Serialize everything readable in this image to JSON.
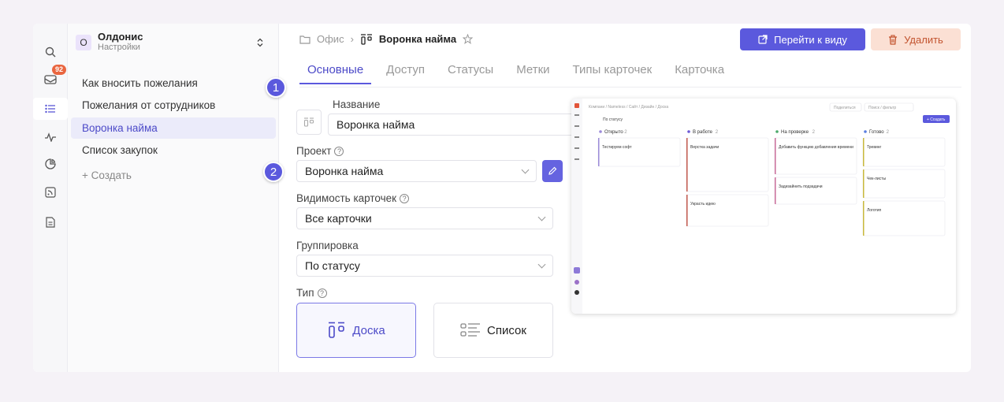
{
  "rail": {
    "badge_count": "92"
  },
  "sidebar": {
    "workspace_initial": "О",
    "workspace_name": "Олдонис",
    "workspace_sub": "Настройки",
    "items": [
      {
        "label": "Как вносить пожелания"
      },
      {
        "label": "Пожелания от сотрудников"
      },
      {
        "label": "Воронка найма"
      },
      {
        "label": "Список закупок"
      }
    ],
    "create_label": "+  Создать"
  },
  "header": {
    "crumb_folder": "Офис",
    "crumb_separator": "›",
    "crumb_current": "Воронка найма",
    "go_button": "Перейти к виду",
    "delete_button": "Удалить"
  },
  "tabs": [
    "Основные",
    "Доступ",
    "Статусы",
    "Метки",
    "Типы карточек",
    "Карточка"
  ],
  "steps": [
    "1",
    "2"
  ],
  "form": {
    "name_label": "Название",
    "name_value": "Воронка найма",
    "project_label": "Проект",
    "project_value": "Воронка найма",
    "visibility_label": "Видимость карточек",
    "visibility_value": "Все карточки",
    "grouping_label": "Группировка",
    "grouping_value": "По статусу",
    "type_label": "Тип",
    "type_board": "Доска",
    "type_list": "Список",
    "help_glyph": "?"
  },
  "preview": {
    "breadcrumb": "Компани / Nameless / Сайт / Дизайн / Доска",
    "share": "Поделиться",
    "search": "Поиск / фильтр",
    "group_by": "По статусу",
    "create": "+ Создать",
    "columns": [
      {
        "title": "Открыто",
        "count": "2",
        "color": "#9b8ad8"
      },
      {
        "title": "В работе",
        "count": "2",
        "color": "#6e5bd6"
      },
      {
        "title": "На проверке",
        "count": "2",
        "color": "#4caa6b"
      },
      {
        "title": "Готово",
        "count": "2",
        "color": "#5b7fe0"
      }
    ],
    "cards": {
      "c1": "Тестируем софт",
      "c2": "Верстка задачи",
      "c3": "Украсть идею",
      "c4": "Добавить функцию добавления времени",
      "c5": "Задизайнить подзадачи",
      "c6": "Тревинг",
      "c7": "Чек-листы",
      "c8": "Логотип"
    }
  }
}
